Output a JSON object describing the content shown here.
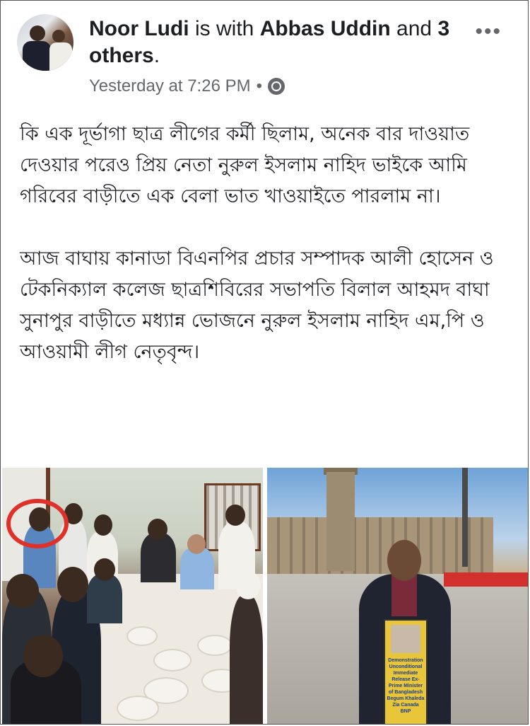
{
  "post": {
    "author": "Noor Ludi",
    "with_text": "is with",
    "tagged": "Abbas Uddin",
    "and_text": "and",
    "others": "3 others",
    "period": ".",
    "timestamp": "Yesterday at 7:26 PM",
    "separator": "•",
    "privacy_icon": "globe-icon",
    "more_icon": "more-options-icon",
    "more_label": "•••"
  },
  "body": {
    "paragraph_1": "কি এক দূর্ভাগা ছাত্র লীগের কর্মী ছিলাম, অনেক বার দাওয়াত দেওয়ার পরেও প্রিয় নেতা নুরুল ইসলাম নাহিদ ভাইকে আমি গরিবের বাড়ীতে এক বেলা ভাত খাওয়াইতে পারলাম না।",
    "paragraph_2": "আজ বাঘায় কানাডা বিএনপির প্রচার সম্পাদক আলী হোসেন ও টেকনিক্যাল কলেজ ছাত্রশিবিরের সভাপতি বিলাল আহমদ বাঘা সুনাপুর বাড়ীতে মধ্যান্ন ভোজনে নুরুল ইসলাম নাহিদ এম,পি ও আওয়ামী লীগ নেতৃবৃন্দ।"
  },
  "photos": {
    "right_sign_text": "Demonstration Unconditional Immediate Release Ex-Prime Minister of Bangladesh Begum Khaleda Zia Canada BNP"
  },
  "colors": {
    "name": "#1c1e21",
    "meta": "#65676b",
    "highlight_circle": "#e0302a"
  }
}
